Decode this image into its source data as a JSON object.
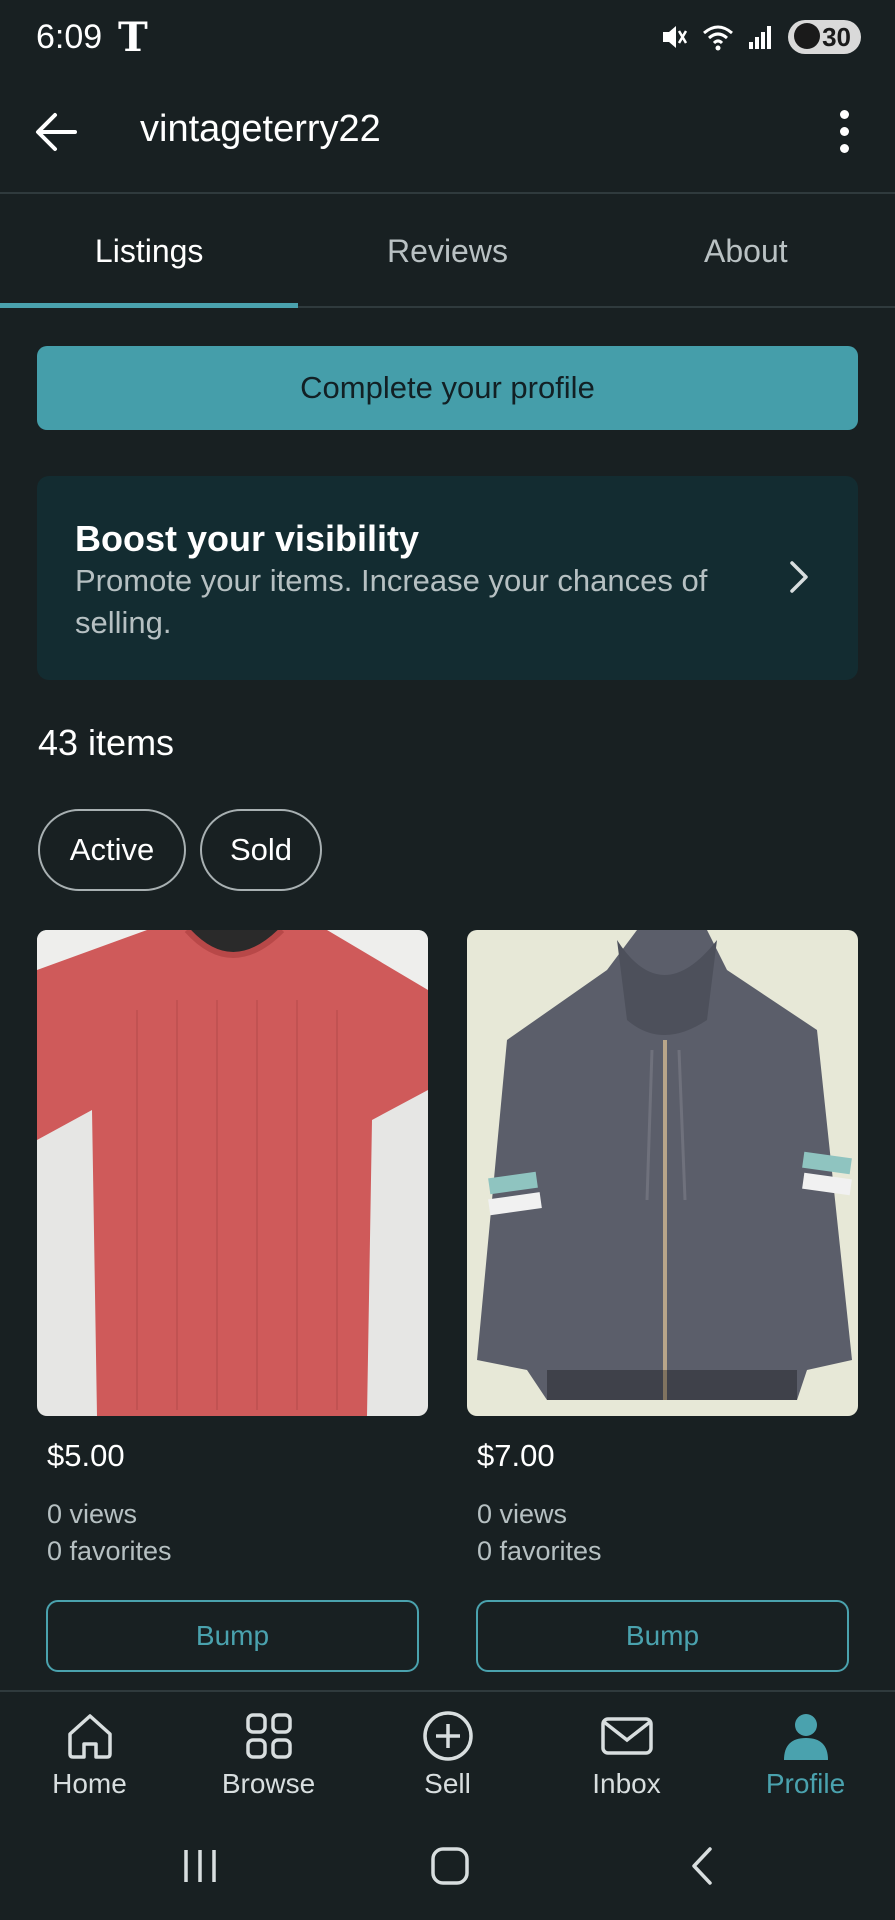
{
  "status_bar": {
    "time": "6:09",
    "carrier": "T",
    "battery": "30"
  },
  "header": {
    "username": "vintageterry22"
  },
  "tabs": [
    {
      "label": "Listings"
    },
    {
      "label": "Reviews"
    },
    {
      "label": "About"
    }
  ],
  "complete_profile": {
    "label": "Complete your profile"
  },
  "boost": {
    "title": "Boost your visibility",
    "subtitle": "Promote your items. Increase your chances of selling."
  },
  "items_count": "43 items",
  "filters": [
    {
      "label": "Active"
    },
    {
      "label": "Sold"
    }
  ],
  "listings": [
    {
      "price": "$5.00",
      "views": "0 views",
      "favorites": "0 favorites",
      "bump_label": "Bump",
      "image": "red ribbed t-shirt"
    },
    {
      "price": "$7.00",
      "views": "0 views",
      "favorites": "0 favorites",
      "bump_label": "Bump",
      "image": "gray zip-up hoodie"
    }
  ],
  "bottom_nav": [
    {
      "label": "Home",
      "icon": "home-icon"
    },
    {
      "label": "Browse",
      "icon": "grid-icon"
    },
    {
      "label": "Sell",
      "icon": "plus-circle-icon"
    },
    {
      "label": "Inbox",
      "icon": "mail-icon"
    },
    {
      "label": "Profile",
      "icon": "person-icon",
      "active": true
    }
  ],
  "colors": {
    "background": "#182022",
    "accent": "#4aa2ae",
    "card": "#132c31",
    "button": "#459eaa"
  }
}
